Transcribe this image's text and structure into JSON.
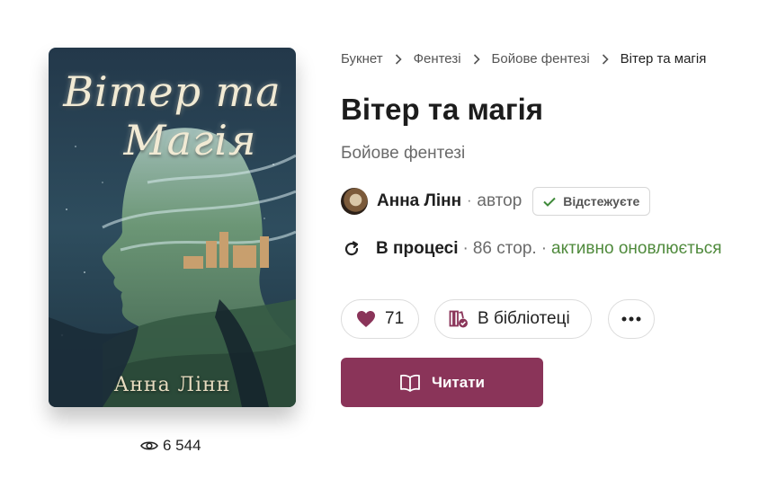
{
  "book": {
    "cover_title_line1": "Вітер та",
    "cover_title_line2": "Магія",
    "cover_author": "Анна Лінн",
    "views": "6 544",
    "title": "Вітер та магія",
    "genre": "Бойове фентезі"
  },
  "breadcrumb": [
    "Букнет",
    "Фентезі",
    "Бойове фентезі",
    "Вітер та магія"
  ],
  "author": {
    "name": "Анна Лінн",
    "separator": "·",
    "role": "автор",
    "follow_label": "Відстежуєте"
  },
  "status": {
    "state": "В процесі",
    "separator": "·",
    "pages": "86 стор.",
    "updating": "активно оновлюється"
  },
  "actions": {
    "likes": "71",
    "library_label": "В бібліотеці",
    "read_label": "Читати"
  },
  "colors": {
    "accent": "#8a3459",
    "green": "#4f8a3c"
  },
  "icons": [
    "eye-icon",
    "chevron-right-icon",
    "check-icon",
    "refresh-icon",
    "heart-icon",
    "library-icon",
    "more-icon",
    "book-open-icon"
  ]
}
